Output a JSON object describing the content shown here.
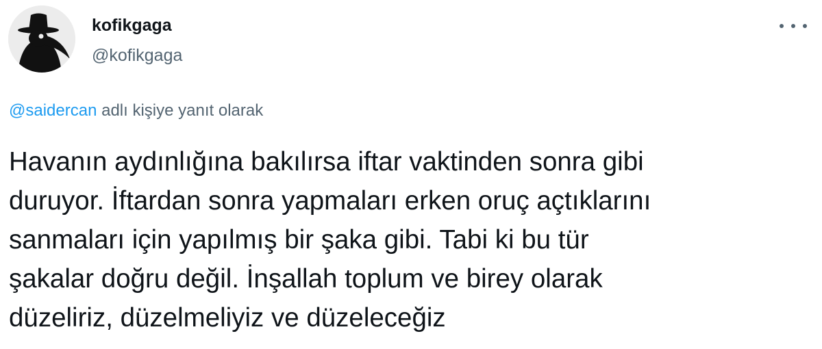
{
  "user": {
    "display_name": "kofikgaga",
    "handle": "@kofikgaga"
  },
  "reply": {
    "mention": "@saidercan",
    "suffix": " adlı kişiye yanıt olarak"
  },
  "tweet": {
    "lines": [
      "Havanın aydınlığına bakılırsa iftar vaktinden sonra gibi",
      "duruyor. İftardan sonra yapmaları erken oruç açtıklarını",
      "sanmaları için yapılmış bir şaka gibi. Tabi ki bu tür",
      "şakalar doğru değil. İnşallah toplum ve birey olarak",
      "düzeliriz, düzelmeliyiz ve düzeleceğiz"
    ]
  },
  "colors": {
    "link": "#1d9bf0",
    "secondary_text": "#536471",
    "primary_text": "#0f1419"
  },
  "icons": {
    "avatar": "plague-doctor-avatar",
    "more": "more-options-icon"
  }
}
